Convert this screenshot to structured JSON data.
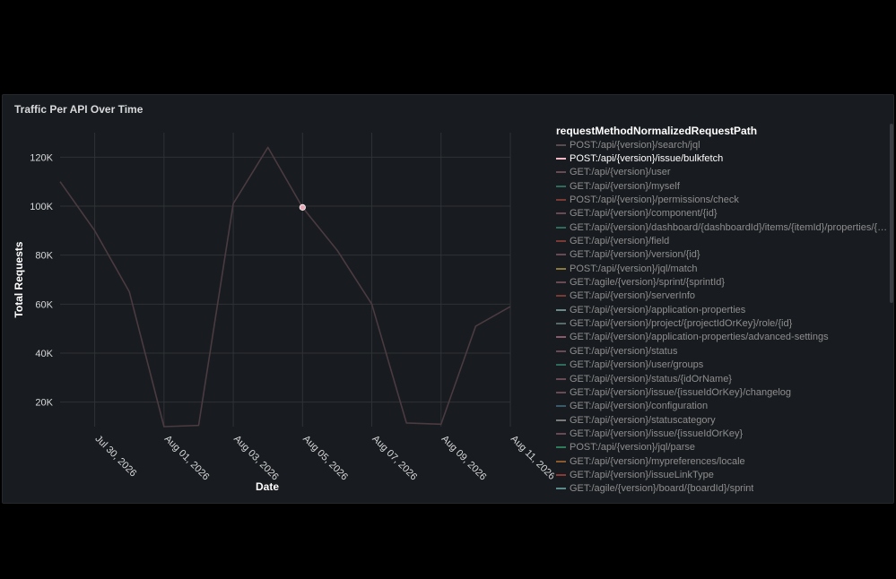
{
  "panel": {
    "title": "Traffic Per API Over Time"
  },
  "chart_data": {
    "type": "line",
    "xlabel": "Date",
    "ylabel": "Total Requests",
    "x_ticks": [
      "Jul 30, 2026",
      "Aug 01, 2026",
      "Aug 03, 2026",
      "Aug 05, 2026",
      "Aug 07, 2026",
      "Aug 09, 2026",
      "Aug 11, 2026"
    ],
    "y_ticks": [
      "20K",
      "40K",
      "60K",
      "80K",
      "100K",
      "120K"
    ],
    "x": [
      "2026-07-29",
      "2026-07-30",
      "2026-07-31",
      "2026-08-01",
      "2026-08-02",
      "2026-08-03",
      "2026-08-04",
      "2026-08-05",
      "2026-08-06",
      "2026-08-07",
      "2026-08-08",
      "2026-08-09",
      "2026-08-10",
      "2026-08-11"
    ],
    "xlim": [
      "2026-07-29",
      "2026-08-11"
    ],
    "ylim": [
      10000,
      130000
    ],
    "grid": true,
    "series": [
      {
        "name": "POST:/api/{version}/search/jql",
        "values": [
          110000,
          90000,
          65000,
          10000,
          10500,
          101000,
          124000,
          99500,
          82000,
          60000,
          11500,
          11000,
          51000,
          59000
        ],
        "highlight_index": 7
      }
    ],
    "legend": {
      "title": "requestMethodNormalizedRequestPath",
      "placement": "right",
      "active_index": 1,
      "items": [
        {
          "label": "POST:/api/{version}/search/jql",
          "color": "#5a4a4e"
        },
        {
          "label": "POST:/api/{version}/issue/bulkfetch",
          "color": "#f5b8c4"
        },
        {
          "label": "GET:/api/{version}/user",
          "color": "#6a4a52"
        },
        {
          "label": "GET:/api/{version}/myself",
          "color": "#2e6b5a"
        },
        {
          "label": "POST:/api/{version}/permissions/check",
          "color": "#7a3a34"
        },
        {
          "label": "GET:/api/{version}/component/{id}",
          "color": "#6a4a52"
        },
        {
          "label": "GET:/api/{version}/dashboard/{dashboardId}/items/{itemId}/properties/{propertyKey}",
          "color": "#2e6b5a"
        },
        {
          "label": "GET:/api/{version}/field",
          "color": "#7a3a34"
        },
        {
          "label": "GET:/api/{version}/version/{id}",
          "color": "#6a4a52"
        },
        {
          "label": "POST:/api/{version}/jql/match",
          "color": "#8a7a3a"
        },
        {
          "label": "GET:/agile/{version}/sprint/{sprintId}",
          "color": "#6a4a52"
        },
        {
          "label": "GET:/api/{version}/serverInfo",
          "color": "#7a3a34"
        },
        {
          "label": "GET:/api/{version}/application-properties",
          "color": "#6a8a8a"
        },
        {
          "label": "GET:/api/{version}/project/{projectIdOrKey}/role/{id}",
          "color": "#5a6a6a"
        },
        {
          "label": "GET:/api/{version}/application-properties/advanced-settings",
          "color": "#8a5a6a"
        },
        {
          "label": "GET:/api/{version}/status",
          "color": "#6a4a52"
        },
        {
          "label": "GET:/api/{version}/user/groups",
          "color": "#2e6b5a"
        },
        {
          "label": "GET:/api/{version}/status/{idOrName}",
          "color": "#6a4a52"
        },
        {
          "label": "GET:/api/{version}/issue/{issueIdOrKey}/changelog",
          "color": "#6a4a52"
        },
        {
          "label": "GET:/api/{version}/configuration",
          "color": "#3a5a6a"
        },
        {
          "label": "GET:/api/{version}/statuscategory",
          "color": "#7a7a7a"
        },
        {
          "label": "GET:/api/{version}/issue/{issueIdOrKey}",
          "color": "#6a4a52"
        },
        {
          "label": "POST:/api/{version}/jql/parse",
          "color": "#2e7a5a"
        },
        {
          "label": "GET:/api/{version}/mypreferences/locale",
          "color": "#8a5a2e"
        },
        {
          "label": "GET:/api/{version}/issueLinkType",
          "color": "#8a3a34"
        },
        {
          "label": "GET:/agile/{version}/board/{boardId}/sprint",
          "color": "#5a8a8a"
        }
      ]
    }
  },
  "colors": {
    "line": "#4a3b40",
    "grid": "#2f3236",
    "point": "#e8a8b6",
    "background": "#181b1f"
  }
}
